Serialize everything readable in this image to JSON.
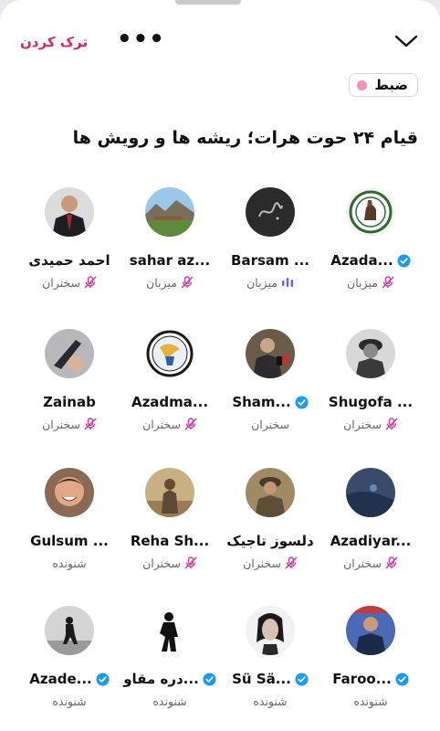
{
  "header": {
    "leave_label": "ترک کردن",
    "more_label": "•••",
    "collapse_icon": "chevron-down-icon"
  },
  "recording": {
    "label": "ضبط",
    "dot_color": "#f48fb8"
  },
  "space": {
    "title": "قیام ۲۴ حوت هرات؛ ریشه ها و رویش ها"
  },
  "colors": {
    "accent": "#e0245e",
    "verified": "#1d9bf0",
    "muted_mic": "#d0399f",
    "speaking": "#7856ff"
  },
  "participants": [
    {
      "name": "Azada...",
      "verified": true,
      "role": "میزبان",
      "muted": true,
      "speaking": false
    },
    {
      "name": "Barsam ...",
      "verified": false,
      "role": "میزبان",
      "muted": false,
      "speaking": true
    },
    {
      "name": "sahar az...",
      "verified": false,
      "role": "میزبان",
      "muted": true,
      "speaking": false
    },
    {
      "name": "احمد حمیدی",
      "verified": false,
      "role": "سخنران",
      "muted": true,
      "speaking": false
    },
    {
      "name": "Shugofa ...",
      "verified": false,
      "role": "سخنران",
      "muted": true,
      "speaking": false
    },
    {
      "name": "Sham...",
      "verified": true,
      "role": "سخنران",
      "muted": false,
      "speaking": false
    },
    {
      "name": "Azadma...",
      "verified": false,
      "role": "سخنران",
      "muted": true,
      "speaking": false
    },
    {
      "name": "Zainab",
      "verified": false,
      "role": "سخنران",
      "muted": true,
      "speaking": false
    },
    {
      "name": "Azadiyar...",
      "verified": false,
      "role": "سخنران",
      "muted": true,
      "speaking": false
    },
    {
      "name": "دلسوز تاجیک",
      "verified": false,
      "role": "سخنران",
      "muted": true,
      "speaking": false
    },
    {
      "name": "Reha Sh...",
      "verified": false,
      "role": "سخنران",
      "muted": true,
      "speaking": false
    },
    {
      "name": "Gulsum ...",
      "verified": false,
      "role": "شنونده",
      "muted": false,
      "speaking": false
    },
    {
      "name": "Faroo...",
      "verified": true,
      "role": "شنونده",
      "muted": false,
      "speaking": false
    },
    {
      "name": "Sü Sä...",
      "verified": true,
      "role": "شنونده",
      "muted": false,
      "speaking": false
    },
    {
      "name": "دره مقاو...",
      "verified": true,
      "role": "شنونده",
      "muted": false,
      "speaking": false
    },
    {
      "name": "Azade...",
      "verified": true,
      "role": "شنونده",
      "muted": false,
      "speaking": false
    }
  ]
}
